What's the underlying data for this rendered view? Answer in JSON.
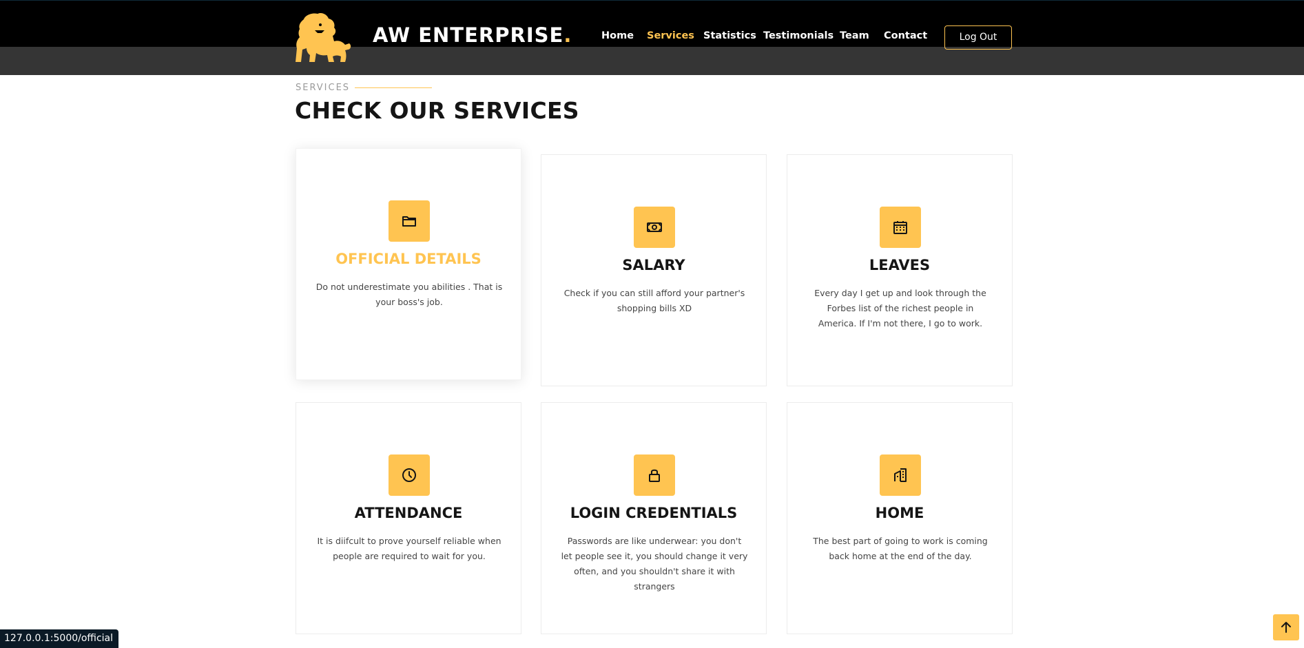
{
  "header": {
    "brand": "AW ENTERPRISE",
    "brand_dot": ".",
    "logo_icon": "lion-logo",
    "nav": [
      {
        "label": "Home",
        "active": false
      },
      {
        "label": "Services",
        "active": true
      },
      {
        "label": "Statistics",
        "active": false
      },
      {
        "label": "Testimonials",
        "active": false
      },
      {
        "label": "Team",
        "active": false
      },
      {
        "label": "Contact",
        "active": false
      }
    ],
    "logout_label": "Log Out"
  },
  "section": {
    "label": "SERVICES",
    "title": "CHECK OUR SERVICES"
  },
  "services": [
    {
      "icon": "folder-icon",
      "title": "OFFICIAL DETAILS",
      "description": "Do not underestimate you abilities . That is your boss's job.",
      "highlighted": true
    },
    {
      "icon": "cash-icon",
      "title": "SALARY",
      "description": "Check if you can still afford your partner's shopping bills XD",
      "highlighted": false
    },
    {
      "icon": "calendar-icon",
      "title": "LEAVES",
      "description": "Every day I get up and look through the Forbes list of the richest people in America. If I'm not there, I go to work.",
      "highlighted": false
    },
    {
      "icon": "clock-icon",
      "title": "ATTENDANCE",
      "description": "It is diifcult to prove yourself reliable when people are required to wait for you.",
      "highlighted": false
    },
    {
      "icon": "lock-icon",
      "title": "LOGIN CREDENTIALS",
      "description": "Passwords are like underwear: you don't let people see it, you should change it very often, and you shouldn't share it with strangers",
      "highlighted": false
    },
    {
      "icon": "building-icon",
      "title": "HOME",
      "description": "The best part of going to work is coming back home at the end of the day.",
      "highlighted": false
    }
  ],
  "status_bar": {
    "url": "127.0.0.1:5000/official"
  },
  "back_to_top_icon": "arrow-up-icon",
  "colors": {
    "accent": "#ffc451",
    "header_bg": "#000000",
    "subbar_bg": "#353535",
    "text_dark": "#151515"
  }
}
